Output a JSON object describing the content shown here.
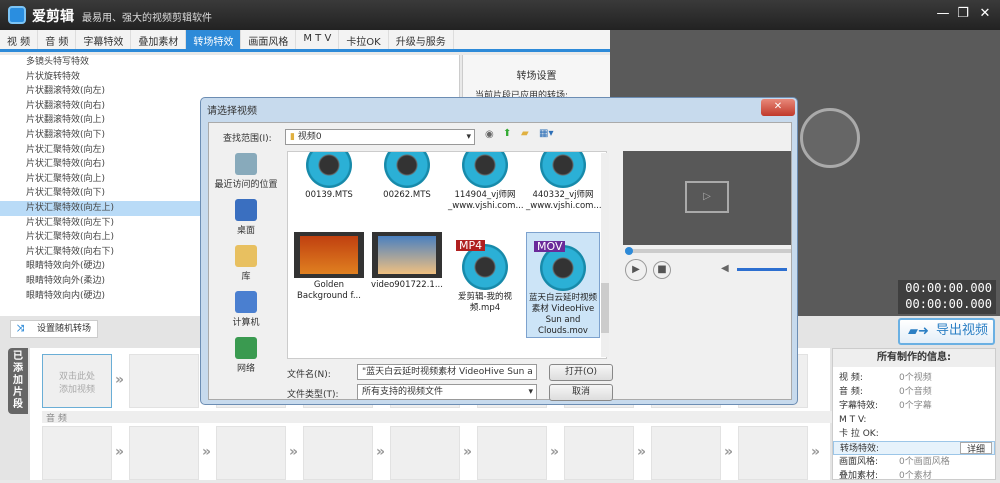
{
  "app": {
    "name": "爱剪辑",
    "slogan": "最易用、强大的视频剪辑软件",
    "accent": "#2d8ad8"
  },
  "tabs": [
    "视 频",
    "音 频",
    "字幕特效",
    "叠加素材",
    "转场特效",
    "画面风格",
    "M T V",
    "卡拉OK",
    "升级与服务"
  ],
  "active_tab": "转场特效",
  "effects": [
    "多镜头特写特效",
    "片状旋转特效",
    "片状翻滚特效(向左)",
    "片状翻滚特效(向右)",
    "片状翻滚特效(向上)",
    "片状翻滚特效(向下)",
    "片状汇聚特效(向左)",
    "片状汇聚特效(向右)",
    "片状汇聚特效(向上)",
    "片状汇聚特效(向下)",
    "片状汇聚特效(向左上)",
    "片状汇聚特效(向左下)",
    "片状汇聚特效(向右上)",
    "片状汇聚特效(向右下)",
    "眼睛特效向外(硬边)",
    "眼睛特效向外(柔边)",
    "眼睛特效向内(硬边)"
  ],
  "selected_effect": "片状汇聚特效(向左上)",
  "settings": {
    "title": "转场设置",
    "applied_label": "当前片段已应用的转场:"
  },
  "timecode": [
    "00:00:00.000",
    "00:00:00.000"
  ],
  "toolbar": {
    "random_label": "设置随机转场",
    "export_label": "导出视频"
  },
  "timeline": {
    "side_tab": "已添加片段",
    "add_hint": "双击此处\n添加视频",
    "audio_label": "音 频"
  },
  "info": {
    "title": "所有制作的信息:",
    "rows": [
      {
        "k": "视    频:",
        "v": "0个视频"
      },
      {
        "k": "音    频:",
        "v": "0个音频"
      },
      {
        "k": "字幕特效:",
        "v": "0个字幕"
      },
      {
        "k": "M  T  V:",
        "v": ""
      },
      {
        "k": "卡 拉 OK:",
        "v": ""
      },
      {
        "k": "转场特效:",
        "v": ""
      },
      {
        "k": "画面风格:",
        "v": "0个画面风格"
      },
      {
        "k": "叠加素材:",
        "v": "0个素材"
      }
    ],
    "detail_btn": "详细"
  },
  "dialog": {
    "title": "请选择视频",
    "lookin_label": "查找范围(I):",
    "folder": "视频0",
    "places": [
      "最近访问的位置",
      "桌面",
      "库",
      "计算机",
      "网络"
    ],
    "files": [
      {
        "name": "00139.MTS"
      },
      {
        "name": "00262.MTS"
      },
      {
        "name": "114904_vj师网_www.vjshi.com..."
      },
      {
        "name": "440332_vj师网_www.vjshi.com..."
      },
      {
        "name": "Golden Background f..."
      },
      {
        "name": "video901722.1..."
      },
      {
        "name": "爱剪辑-我的视频.mp4",
        "badge": "MP4"
      },
      {
        "name": "蓝天白云延时视频素材 VideoHive Sun and Clouds.mov",
        "badge": "MOV",
        "selected": true
      }
    ],
    "filename_label": "文件名(N):",
    "filename_value": "\"蓝天白云延时视频素材 VideoHive Sun a",
    "filetype_label": "文件类型(T):",
    "filetype_value": "所有支持的视频文件",
    "open_btn": "打开(O)",
    "cancel_btn": "取消"
  }
}
